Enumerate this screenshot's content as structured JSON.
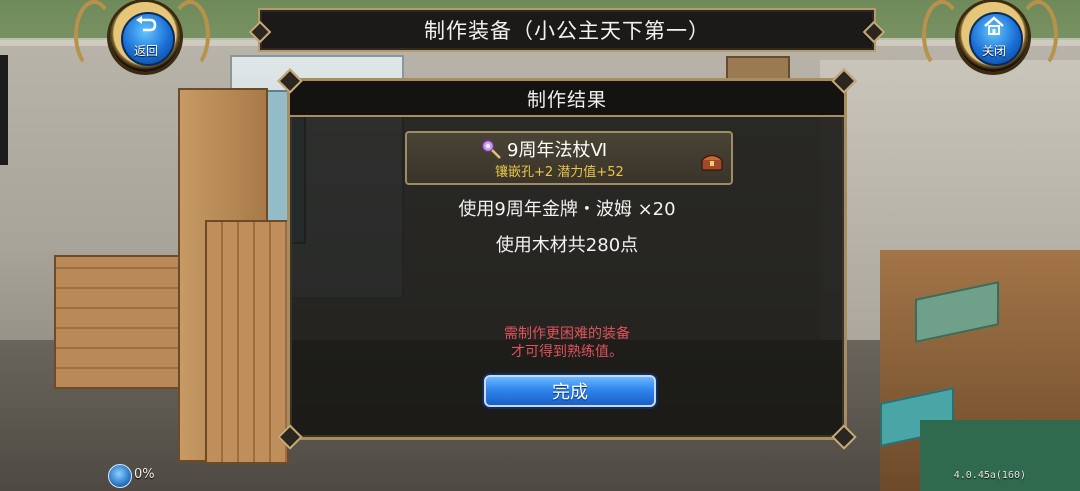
{
  "header": {
    "title": "制作装备（小公主天下第一）"
  },
  "buttons": {
    "back_label": "返回",
    "back_icon": "return-arrow-icon",
    "close_label": "关闭",
    "close_icon": "house-icon"
  },
  "dialog": {
    "title": "制作结果",
    "item": {
      "name": "9周年法杖Ⅵ",
      "stats": "镶嵌孔+2  潜力值+52",
      "icon": "staff-icon",
      "chest_icon": "treasure-chest-icon"
    },
    "usage_line1": "使用9周年金牌・波姆  ×20",
    "usage_line2": "使用木材共280点",
    "hint_line1": "需制作更困难的装备",
    "hint_line2": "才可得到熟练值。",
    "done_label": "完成"
  },
  "status": {
    "percent": "0%",
    "version": "4.0.45a(160)"
  },
  "colors": {
    "accent_gold": "#a88d5e",
    "hint_red": "#e0525a",
    "stat_yellow": "#e8c64a",
    "button_blue": "#2f86ec"
  }
}
